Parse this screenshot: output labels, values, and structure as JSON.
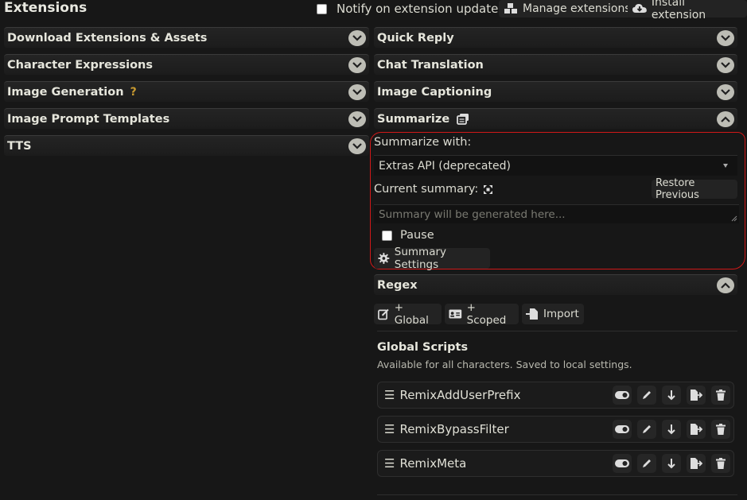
{
  "header": {
    "title": "Extensions",
    "notify_label": "Notify on extension updates",
    "manage_label": "Manage extensions",
    "install_label": "Install extension"
  },
  "left_drawers": [
    {
      "label": "Download Extensions & Assets"
    },
    {
      "label": "Character Expressions"
    },
    {
      "label": "Image Generation",
      "hint": "?"
    },
    {
      "label": "Image Prompt Templates"
    },
    {
      "label": "TTS"
    }
  ],
  "right_drawers": [
    {
      "label": "Quick Reply"
    },
    {
      "label": "Chat Translation"
    },
    {
      "label": "Image Captioning"
    },
    {
      "label": "Summarize"
    }
  ],
  "summarize": {
    "with_label": "Summarize with:",
    "with_value": "Extras API (deprecated)",
    "current_label": "Current summary:",
    "restore_label": "Restore Previous",
    "placeholder": "Summary will be generated here...",
    "pause_label": "Pause",
    "settings_label": "Summary Settings"
  },
  "regex": {
    "title": "Regex",
    "global_btn": "+ Global",
    "scoped_btn": "+ Scoped",
    "import_btn": "Import",
    "scripts_title": "Global Scripts",
    "scripts_desc": "Available for all characters. Saved to local settings.",
    "scripts": [
      {
        "name": "RemixAddUserPrefix"
      },
      {
        "name": "RemixBypassFilter"
      },
      {
        "name": "RemixMeta"
      }
    ]
  },
  "colors": {
    "background": "#171717",
    "highlight": "#d01818",
    "hint": "#c89a30"
  }
}
